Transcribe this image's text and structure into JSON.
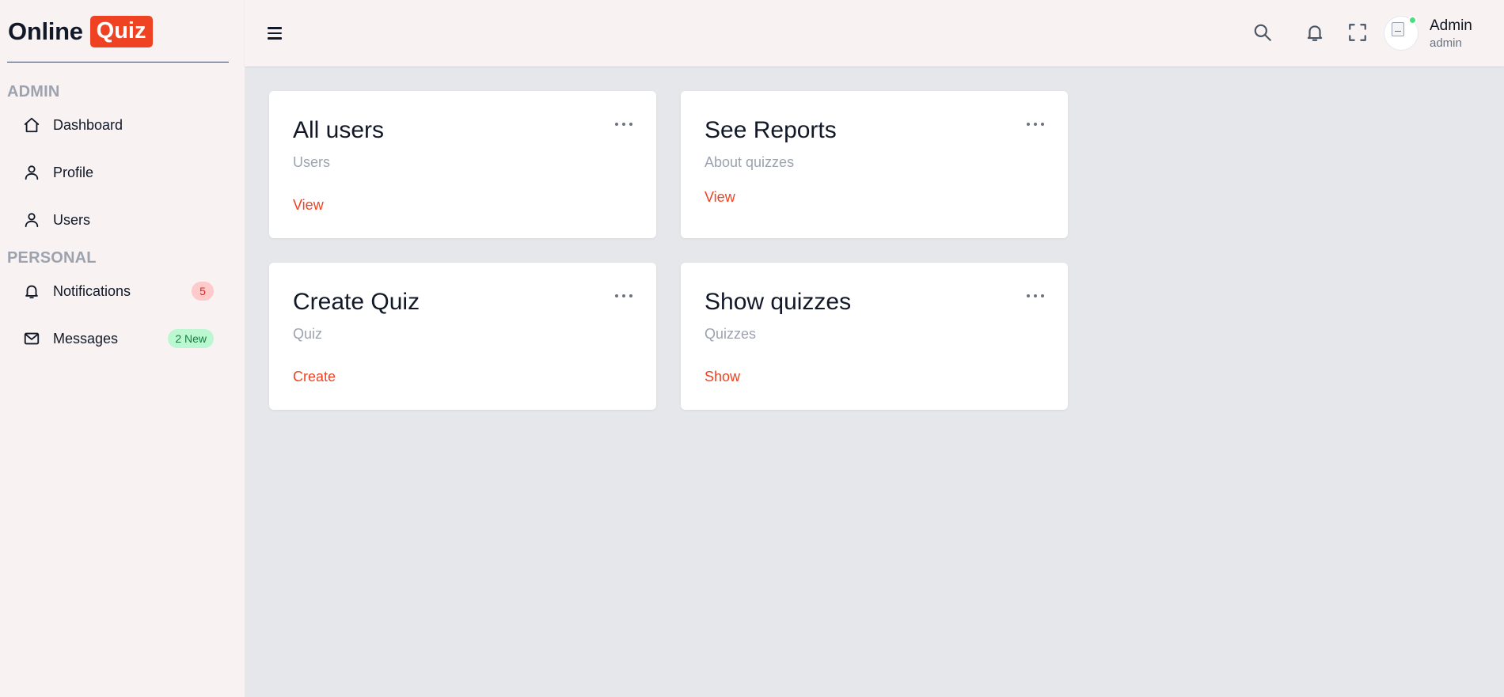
{
  "brand": {
    "part1": "Online",
    "part2": "Quiz",
    "accent": "#ef4223"
  },
  "sidebar": {
    "sections": [
      {
        "label": "ADMIN"
      },
      {
        "label": "PERSONAL"
      }
    ],
    "items": [
      {
        "label": "Dashboard",
        "icon": "home-icon"
      },
      {
        "label": "Profile",
        "icon": "user-icon"
      },
      {
        "label": "Users",
        "icon": "user-icon"
      },
      {
        "label": "Notifications",
        "icon": "bell-icon",
        "badge": "5"
      },
      {
        "label": "Messages",
        "icon": "mail-icon",
        "badge": "2 New"
      }
    ]
  },
  "topbar": {
    "icons": [
      "menu-icon",
      "search-icon",
      "bell-icon",
      "fullscreen-icon"
    ],
    "user": {
      "name": "Admin",
      "role": "admin"
    }
  },
  "cards": [
    {
      "title": "All users",
      "subtitle": "Users",
      "link": "View"
    },
    {
      "title": "See Reports",
      "subtitle": "About quizzes",
      "link": "View"
    },
    {
      "title": "Create Quiz",
      "subtitle": "Quiz",
      "link": "Create"
    },
    {
      "title": "Show quizzes",
      "subtitle": "Quizzes",
      "link": "Show"
    }
  ]
}
